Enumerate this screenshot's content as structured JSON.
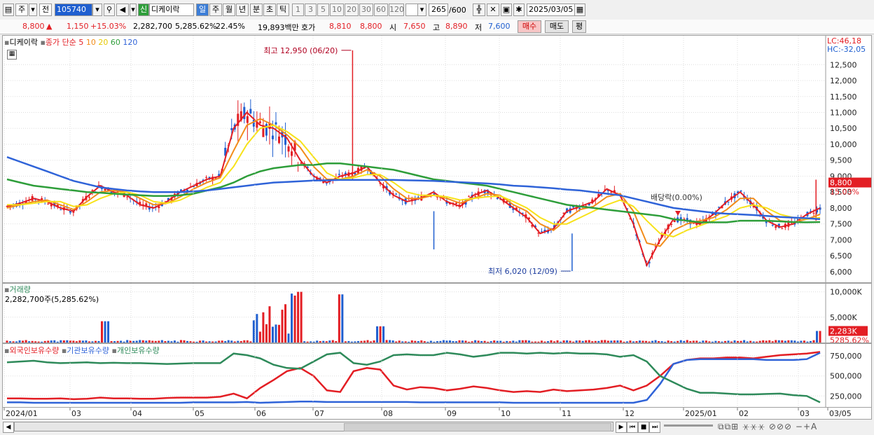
{
  "toolbar": {
    "market": "주",
    "type": "전",
    "code": "105740",
    "name_badge": "신",
    "name": "디케이락",
    "periods": [
      "일",
      "주",
      "월",
      "년",
      "분",
      "초",
      "틱"
    ],
    "ticks": [
      "1",
      "3",
      "5",
      "10",
      "20",
      "30",
      "60",
      "120"
    ],
    "count": "265",
    "count_total": "/600",
    "date": "2025/03/05"
  },
  "quote": {
    "price": "8,800",
    "arrow": "▲",
    "change": "1,150",
    "change_pct": "+15.03%",
    "volume": "2,282,700",
    "volume_pct": "5,285.62%",
    "turnover": "22.45%",
    "amount": "19,893백만",
    "bid_label": "호가",
    "bid1": "8,810",
    "bid2": "8,800",
    "open_label": "시",
    "open": "7,650",
    "high_label": "고",
    "high": "8,890",
    "low_label": "저",
    "low": "7,600",
    "buy": "매수",
    "sell": "매도",
    "avg": "평"
  },
  "price_panel": {
    "title": "디케이락",
    "ma_label": "종가 단순",
    "ma_periods": [
      "5",
      "10",
      "20",
      "60",
      "120"
    ],
    "lc": "LC:46,18",
    "hc": "HC:-32,05",
    "annotation_high": "최고 12,950 (06/20)",
    "annotation_low": "최저 6,020 (12/09)",
    "annotation_div": "배당락(0.00%)",
    "last_price": "8,800",
    "last_pct": "15.03%"
  },
  "volume_panel": {
    "title": "거래량",
    "value": "2,282,700주(5,285.62%)",
    "last": "2,283K",
    "last_pct": "5285.62%"
  },
  "holding_panel": {
    "legend": [
      "외국인보유수량",
      "기관보유수량",
      "개인보유수량"
    ]
  },
  "colors": {
    "up": "#e31e24",
    "down": "#1f5fd0",
    "ma5": "#e31e24",
    "ma10": "#f28c1a",
    "ma20": "#f7e21a",
    "ma60": "#2e9e3a",
    "ma120": "#2f63d8",
    "foreign": "#e31e24",
    "institution": "#2f63d8",
    "individual": "#2e8a5a"
  },
  "chart_data": [
    {
      "type": "candlestick",
      "title": "디케이락",
      "y_ticks": [
        "12,500",
        "12,000",
        "11,500",
        "11,000",
        "10,500",
        "10,000",
        "9,500",
        "9,000",
        "8,500",
        "8,000",
        "7,500",
        "7,000",
        "6,500",
        "6,000"
      ],
      "ylim": [
        5800,
        13100
      ],
      "x_ticks": [
        "2024/01",
        "03",
        "04",
        "05",
        "06",
        "07",
        "08",
        "09",
        "10",
        "11",
        "12",
        "2025/01",
        "02",
        "03",
        "03/05"
      ],
      "series": [
        {
          "name": "종가 단순 5",
          "values": [
            8050,
            8150,
            8300,
            8200,
            8000,
            7900,
            8350,
            8700,
            8500,
            8400,
            8100,
            8000,
            8200,
            8500,
            8700,
            8900,
            9000,
            10500,
            11000,
            10600,
            10500,
            10200,
            9500,
            9000,
            8800,
            9000,
            9100,
            9300,
            8800,
            8400,
            8200,
            8300,
            8500,
            8200,
            8050,
            8400,
            8550,
            8300,
            8000,
            7700,
            7200,
            7350,
            7900,
            8050,
            8200,
            8600,
            8400,
            7500,
            6200,
            7000,
            7650,
            7600,
            7500,
            7800,
            8200,
            8500,
            8100,
            7600,
            7400,
            7500,
            7800,
            8000
          ]
        },
        {
          "name": "종가 단순 10",
          "values": [
            8000,
            8100,
            8200,
            8250,
            8100,
            7950,
            8200,
            8500,
            8550,
            8500,
            8300,
            8100,
            8150,
            8350,
            8600,
            8800,
            8950,
            9800,
            10600,
            10800,
            10600,
            10300,
            9900,
            9300,
            8900,
            8900,
            9000,
            9200,
            9000,
            8600,
            8300,
            8300,
            8400,
            8300,
            8150,
            8300,
            8450,
            8400,
            8100,
            7900,
            7500,
            7300,
            7650,
            7950,
            8050,
            8350,
            8450,
            7900,
            6900,
            6800,
            7300,
            7500,
            7600,
            7700,
            7950,
            8300,
            8300,
            7900,
            7600,
            7550,
            7650,
            7800
          ]
        },
        {
          "name": "종가 단순 20",
          "values": [
            8100,
            8100,
            8150,
            8200,
            8200,
            8050,
            8100,
            8300,
            8450,
            8500,
            8400,
            8200,
            8150,
            8250,
            8450,
            8650,
            8800,
            9300,
            10000,
            10500,
            10600,
            10400,
            10100,
            9600,
            9100,
            8900,
            8950,
            9050,
            9050,
            8800,
            8500,
            8400,
            8400,
            8350,
            8250,
            8300,
            8350,
            8380,
            8200,
            8000,
            7700,
            7500,
            7500,
            7700,
            7900,
            8100,
            8250,
            8050,
            7600,
            7200,
            7100,
            7300,
            7450,
            7600,
            7750,
            8000,
            8100,
            8000,
            7800,
            7700,
            7650,
            7700
          ]
        },
        {
          "name": "종가 단순 60",
          "values": [
            8900,
            8800,
            8700,
            8650,
            8600,
            8550,
            8500,
            8480,
            8450,
            8420,
            8400,
            8380,
            8380,
            8400,
            8450,
            8550,
            8650,
            8800,
            9000,
            9150,
            9250,
            9300,
            9350,
            9350,
            9400,
            9400,
            9350,
            9300,
            9250,
            9200,
            9100,
            9000,
            8900,
            8850,
            8800,
            8750,
            8700,
            8600,
            8500,
            8400,
            8300,
            8200,
            8100,
            8050,
            8000,
            7950,
            7900,
            7850,
            7800,
            7750,
            7650,
            7600,
            7550,
            7550,
            7550,
            7600,
            7600,
            7600,
            7580,
            7560,
            7550,
            7560
          ]
        },
        {
          "name": "종가 단순 120",
          "values": [
            9600,
            9450,
            9300,
            9150,
            9000,
            8850,
            8750,
            8650,
            8600,
            8550,
            8520,
            8500,
            8500,
            8500,
            8520,
            8550,
            8600,
            8650,
            8700,
            8750,
            8800,
            8820,
            8840,
            8860,
            8870,
            8880,
            8880,
            8880,
            8880,
            8880,
            8870,
            8860,
            8850,
            8830,
            8810,
            8790,
            8770,
            8740,
            8700,
            8680,
            8650,
            8620,
            8580,
            8550,
            8500,
            8450,
            8400,
            8300,
            8200,
            8100,
            8000,
            7950,
            7900,
            7850,
            7820,
            7800,
            7780,
            7750,
            7720,
            7700,
            7680,
            7650
          ]
        }
      ]
    },
    {
      "type": "bar",
      "title": "거래량",
      "y_ticks": [
        "10,000K",
        "5,000K"
      ],
      "ylim": [
        0,
        10500
      ]
    },
    {
      "type": "line",
      "y_ticks": [
        "750,000",
        "500,000",
        "250,000"
      ],
      "ylim": [
        130000,
        830000
      ],
      "series": [
        {
          "name": "외국인보유수량",
          "values": [
            220000,
            220000,
            215000,
            215000,
            220000,
            210000,
            215000,
            230000,
            220000,
            220000,
            215000,
            215000,
            225000,
            230000,
            230000,
            230000,
            240000,
            280000,
            220000,
            350000,
            450000,
            560000,
            600000,
            500000,
            320000,
            300000,
            560000,
            600000,
            580000,
            380000,
            330000,
            360000,
            350000,
            320000,
            340000,
            370000,
            350000,
            320000,
            300000,
            310000,
            300000,
            330000,
            310000,
            320000,
            330000,
            350000,
            380000,
            320000,
            380000,
            500000,
            650000,
            700000,
            720000,
            720000,
            730000,
            730000,
            720000,
            740000,
            760000,
            770000,
            780000,
            800000
          ]
        },
        {
          "name": "기관보유수량",
          "values": [
            170000,
            170000,
            165000,
            165000,
            165000,
            165000,
            165000,
            165000,
            165000,
            165000,
            165000,
            165000,
            165000,
            165000,
            170000,
            170000,
            170000,
            170000,
            175000,
            165000,
            170000,
            175000,
            180000,
            180000,
            175000,
            175000,
            175000,
            175000,
            175000,
            175000,
            175000,
            170000,
            170000,
            170000,
            170000,
            170000,
            170000,
            170000,
            165000,
            165000,
            165000,
            165000,
            165000,
            165000,
            165000,
            165000,
            165000,
            165000,
            200000,
            400000,
            650000,
            700000,
            710000,
            710000,
            710000,
            710000,
            710000,
            700000,
            700000,
            700000,
            710000,
            790000
          ]
        },
        {
          "name": "개인보유수량",
          "values": [
            670000,
            680000,
            690000,
            670000,
            660000,
            665000,
            670000,
            660000,
            665000,
            660000,
            660000,
            655000,
            650000,
            655000,
            660000,
            660000,
            660000,
            780000,
            760000,
            720000,
            640000,
            600000,
            590000,
            680000,
            770000,
            790000,
            660000,
            640000,
            680000,
            760000,
            770000,
            760000,
            760000,
            790000,
            770000,
            740000,
            760000,
            790000,
            790000,
            780000,
            790000,
            780000,
            790000,
            780000,
            780000,
            770000,
            740000,
            760000,
            680000,
            500000,
            420000,
            340000,
            290000,
            290000,
            280000,
            270000,
            270000,
            275000,
            280000,
            260000,
            250000,
            170000
          ]
        }
      ]
    }
  ]
}
